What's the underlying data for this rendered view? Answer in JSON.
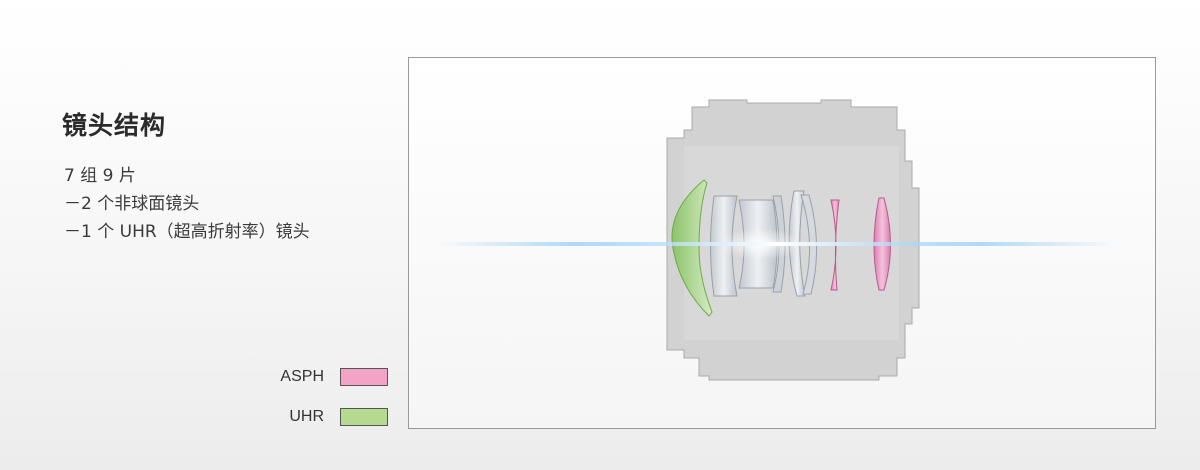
{
  "heading": "镜头结构",
  "specs": {
    "groups_elements": "7 组 9 片",
    "aspherical": "－2 个非球面镜头",
    "uhr": "－1 个 UHR（超高折射率）镜头"
  },
  "legend": [
    {
      "label": "ASPH",
      "color": "#f2a3c6"
    },
    {
      "label": "UHR",
      "color": "#b5d98e"
    }
  ],
  "colors": {
    "barrel": "#cfcfcf",
    "glass": "#d9dde2",
    "light_beam": "#7fc4f0"
  }
}
